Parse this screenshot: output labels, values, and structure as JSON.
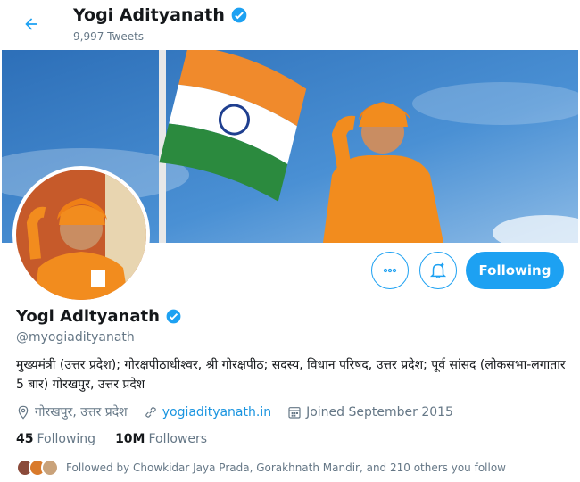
{
  "header": {
    "name": "Yogi Adityanath",
    "tweet_count": "9,997 Tweets"
  },
  "profile": {
    "name": "Yogi Adityanath",
    "handle": "@myogiadityanath",
    "bio": "मुख्यमंत्री (उत्तर प्रदेश); गोरक्षपीठाधीश्वर, श्री गोरक्षपीठ; सदस्य, विधान परिषद, उत्तर प्रदेश; पूर्व सांसद (लोकसभा-लगातार 5 बार) गोरखपुर, उत्तर प्रदेश",
    "location": "गोरखपुर, उत्तर प्रदेश",
    "website": "yogiadityanath.in",
    "joined": "Joined September 2015"
  },
  "actions": {
    "following_label": "Following"
  },
  "stats": {
    "following_count": "45",
    "following_label": "Following",
    "followers_count": "10M",
    "followers_label": "Followers"
  },
  "followed_by": "Followed by Chowkidar Jaya Prada, Gorakhnath Mandir, and 210 others you follow",
  "colors": {
    "accent": "#1da1f2",
    "saffron": "#f28c1e",
    "sky": "#3f82c8"
  },
  "icons": [
    "back-arrow-icon",
    "verified-badge-icon",
    "more-icon",
    "bell-icon",
    "location-icon",
    "link-icon",
    "calendar-icon"
  ]
}
